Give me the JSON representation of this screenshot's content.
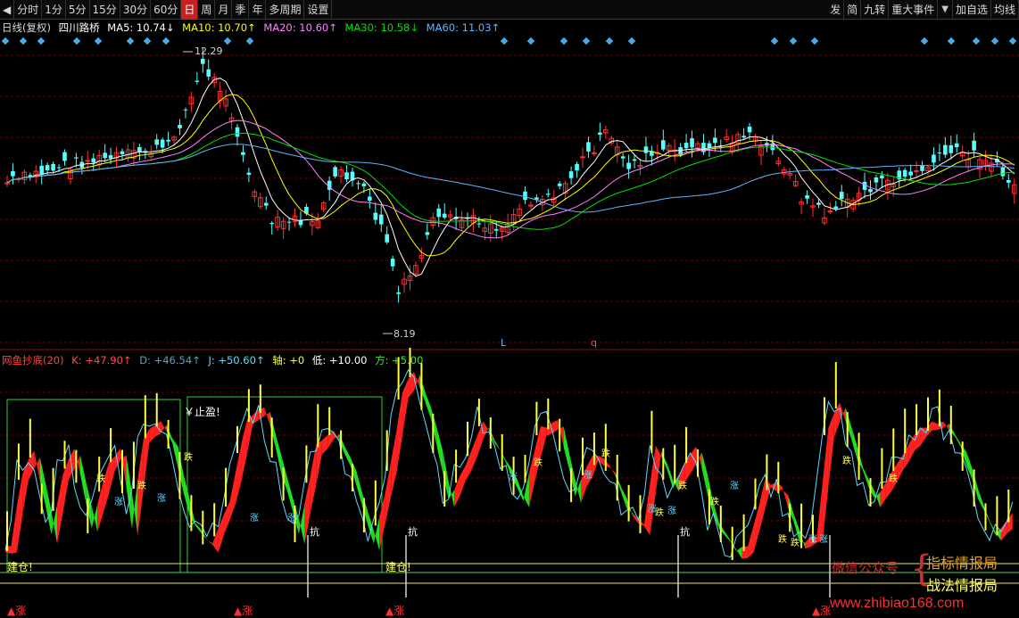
{
  "toolbar": {
    "back_icon": "back-arrow-icon",
    "left_items": [
      "分时",
      "1分",
      "5分",
      "15分",
      "30分",
      "60分",
      "日",
      "周",
      "月",
      "季",
      "年",
      "多周期",
      "设置"
    ],
    "active_label": "日",
    "right_items": [
      "发",
      "简",
      "九转",
      "重大事件",
      "加自选",
      "均线"
    ],
    "dropdown_icon": "dropdown-arrow-icon"
  },
  "ma_legend": {
    "prefix": "日线(复权)",
    "stock": "四川路桥",
    "ma5": "MA5: 10.74↓",
    "ma10": "MA10: 10.70↑",
    "ma20": "MA20: 10.60↑",
    "ma30": "MA30: 10.58↓",
    "ma60": "MA60: 11.03↑"
  },
  "colors": {
    "up": "#ff3030",
    "down": "#54ffff",
    "ma5": "#ffffff",
    "ma10": "#ffff00",
    "ma20": "#ff80ff",
    "ma30": "#00e000",
    "ma60": "#5fb4ff",
    "grid": "#6a0000",
    "k_line": "#ffff40",
    "d_line": "#60d8ff",
    "band_bull": "#ff2020",
    "band_bear": "#20e020"
  },
  "price_labels": {
    "high": "12.29",
    "low": "8.19"
  },
  "markers": {
    "l": "L",
    "q": "q"
  },
  "indicator": {
    "name": "网鱼抄底(20)",
    "k": "K: +47.90↑",
    "d": "D: +46.54↑",
    "j": "J: +50.60↑",
    "axis": "轴: +0",
    "low": "低: +10.00",
    "square": "方: +5.00"
  },
  "signals": {
    "take_profit": "￥止盈!",
    "build": "建仓!",
    "rise": "▲涨",
    "die": "跌",
    "zhang": "涨",
    "kang": "抗"
  },
  "watermark": {
    "wechat": "微信公众号",
    "brace": "{",
    "line1": "指标情报局",
    "line2": "战法情报局",
    "url": "www.zhibiao168.com"
  }
}
